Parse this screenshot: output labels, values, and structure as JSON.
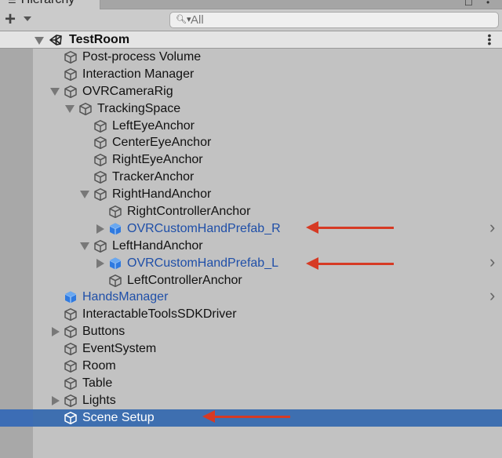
{
  "window": {
    "tab_title": "Hierarchy",
    "tab_icon": "hierarchy-list-icon"
  },
  "toolbar": {
    "add_label": "+",
    "search_placeholder": "All",
    "search_value": ""
  },
  "scene": {
    "name": "TestRoom",
    "expanded": true,
    "icon": "unity-scene-icon"
  },
  "colors": {
    "selection": "#3e6fb0",
    "prefab_text": "#1f4fa8",
    "annotation_arrow": "#d63a24",
    "background": "#c2c2c2"
  },
  "rows": [
    {
      "label": "Post-process Volume",
      "depth": 0,
      "fold": "none",
      "type": "gameobject",
      "selected": false,
      "has_chevron": false,
      "annotated": false
    },
    {
      "label": "Interaction Manager",
      "depth": 0,
      "fold": "none",
      "type": "gameobject",
      "selected": false,
      "has_chevron": false,
      "annotated": false
    },
    {
      "label": "OVRCameraRig",
      "depth": 0,
      "fold": "expanded",
      "type": "gameobject",
      "selected": false,
      "has_chevron": false,
      "annotated": false
    },
    {
      "label": "TrackingSpace",
      "depth": 1,
      "fold": "expanded",
      "type": "gameobject",
      "selected": false,
      "has_chevron": false,
      "annotated": false
    },
    {
      "label": "LeftEyeAnchor",
      "depth": 2,
      "fold": "none",
      "type": "gameobject",
      "selected": false,
      "has_chevron": false,
      "annotated": false
    },
    {
      "label": "CenterEyeAnchor",
      "depth": 2,
      "fold": "none",
      "type": "gameobject",
      "selected": false,
      "has_chevron": false,
      "annotated": false
    },
    {
      "label": "RightEyeAnchor",
      "depth": 2,
      "fold": "none",
      "type": "gameobject",
      "selected": false,
      "has_chevron": false,
      "annotated": false
    },
    {
      "label": "TrackerAnchor",
      "depth": 2,
      "fold": "none",
      "type": "gameobject",
      "selected": false,
      "has_chevron": false,
      "annotated": false
    },
    {
      "label": "RightHandAnchor",
      "depth": 2,
      "fold": "expanded",
      "type": "gameobject",
      "selected": false,
      "has_chevron": false,
      "annotated": false
    },
    {
      "label": "RightControllerAnchor",
      "depth": 3,
      "fold": "none",
      "type": "gameobject",
      "selected": false,
      "has_chevron": false,
      "annotated": false
    },
    {
      "label": "OVRCustomHandPrefab_R",
      "depth": 3,
      "fold": "collapsed",
      "type": "prefab",
      "selected": false,
      "has_chevron": true,
      "annotated": true
    },
    {
      "label": "LeftHandAnchor",
      "depth": 2,
      "fold": "expanded",
      "type": "gameobject",
      "selected": false,
      "has_chevron": false,
      "annotated": false
    },
    {
      "label": "OVRCustomHandPrefab_L",
      "depth": 3,
      "fold": "collapsed",
      "type": "prefab",
      "selected": false,
      "has_chevron": true,
      "annotated": true
    },
    {
      "label": "LeftControllerAnchor",
      "depth": 3,
      "fold": "none",
      "type": "gameobject",
      "selected": false,
      "has_chevron": false,
      "annotated": false
    },
    {
      "label": "HandsManager",
      "depth": 0,
      "fold": "none",
      "type": "prefab",
      "selected": false,
      "has_chevron": true,
      "annotated": false
    },
    {
      "label": "InteractableToolsSDKDriver",
      "depth": 0,
      "fold": "none",
      "type": "gameobject",
      "selected": false,
      "has_chevron": false,
      "annotated": false
    },
    {
      "label": "Buttons",
      "depth": 0,
      "fold": "collapsed",
      "type": "gameobject",
      "selected": false,
      "has_chevron": false,
      "annotated": false
    },
    {
      "label": "EventSystem",
      "depth": 0,
      "fold": "none",
      "type": "gameobject",
      "selected": false,
      "has_chevron": false,
      "annotated": false
    },
    {
      "label": "Room",
      "depth": 0,
      "fold": "none",
      "type": "gameobject",
      "selected": false,
      "has_chevron": false,
      "annotated": false
    },
    {
      "label": "Table",
      "depth": 0,
      "fold": "none",
      "type": "gameobject",
      "selected": false,
      "has_chevron": false,
      "annotated": false
    },
    {
      "label": "Lights",
      "depth": 0,
      "fold": "collapsed",
      "type": "gameobject",
      "selected": false,
      "has_chevron": false,
      "annotated": false
    },
    {
      "label": "Scene Setup",
      "depth": 0,
      "fold": "none",
      "type": "gameobject",
      "selected": true,
      "has_chevron": false,
      "annotated": true
    }
  ]
}
